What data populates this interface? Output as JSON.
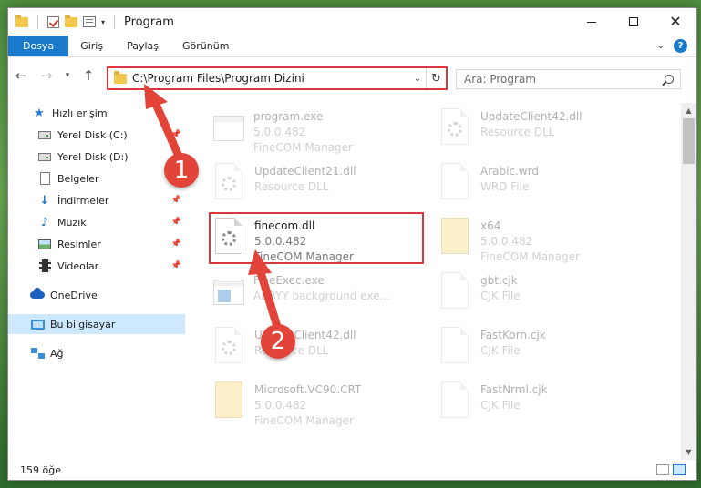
{
  "window": {
    "title": "Program"
  },
  "ribbon": {
    "tabs": [
      "Dosya",
      "Giriş",
      "Paylaş",
      "Görünüm"
    ],
    "help": "?"
  },
  "nav": {
    "address": "C:\\Program Files\\Program Dizini",
    "search_placeholder": "Ara: Program"
  },
  "sidebar": {
    "items": [
      {
        "label": "Hızlı erişim",
        "icon": "star-icon"
      },
      {
        "label": "Yerel Disk (C:)",
        "icon": "drive-icon"
      },
      {
        "label": "Yerel Disk (D:)",
        "icon": "drive-icon"
      },
      {
        "label": "Belgeler",
        "icon": "documents-icon"
      },
      {
        "label": "İndirmeler",
        "icon": "downloads-icon"
      },
      {
        "label": "Müzik",
        "icon": "music-icon"
      },
      {
        "label": "Resimler",
        "icon": "pictures-icon"
      },
      {
        "label": "Videolar",
        "icon": "videos-icon"
      },
      {
        "label": "OneDrive",
        "icon": "cloud-icon"
      },
      {
        "label": "Bu bilgisayar",
        "icon": "computer-icon"
      },
      {
        "label": "Ağ",
        "icon": "network-icon"
      }
    ]
  },
  "files": [
    {
      "name": "program.exe",
      "sub1": "5.0.0.482",
      "sub2": "FineCOM Manager"
    },
    {
      "name": "UpdateClient42.dll",
      "sub1": "Resource DLL",
      "sub2": ""
    },
    {
      "name": "UpdateClient21.dll",
      "sub1": "Resource DLL",
      "sub2": ""
    },
    {
      "name": "Arabic.wrd",
      "sub1": "WRD File",
      "sub2": ""
    },
    {
      "name": "finecom.dll",
      "sub1": "5.0.0.482",
      "sub2": "FineCOM Manager"
    },
    {
      "name": "x64",
      "sub1": "5.0.0.482",
      "sub2": "FineCOM Manager"
    },
    {
      "name": "FineExec.exe",
      "sub1": "ABBYY background exe...",
      "sub2": ""
    },
    {
      "name": "gbt.cjk",
      "sub1": "CJK File",
      "sub2": ""
    },
    {
      "name": "UpdateClient42.dll",
      "sub1": "Resource DLL",
      "sub2": ""
    },
    {
      "name": "FastKorn.cjk",
      "sub1": "CJK File",
      "sub2": ""
    },
    {
      "name": "Microsoft.VC90.CRT",
      "sub1": "5.0.0.482",
      "sub2": "FineCOM Manager"
    },
    {
      "name": "FastNrml.cjk",
      "sub1": "CJK File",
      "sub2": ""
    }
  ],
  "status": {
    "count": "159 öğe"
  },
  "annotations": {
    "step1": "1",
    "step2": "2"
  },
  "colors": {
    "accent": "#1979ca",
    "highlight": "#d7383b",
    "badge": "#e2443a"
  }
}
